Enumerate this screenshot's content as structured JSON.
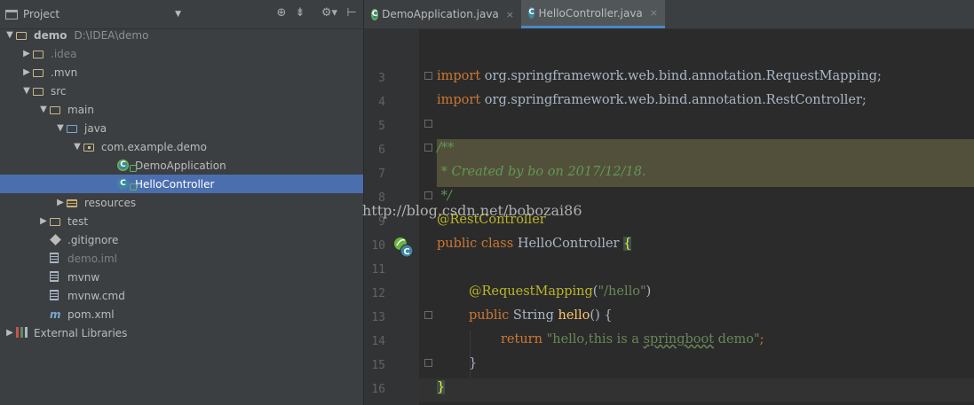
{
  "project_panel": {
    "title": "Project",
    "tree": [
      {
        "label": "demo",
        "path": "D:\\IDEA\\demo",
        "indent": 0,
        "expanded": true,
        "icon": "module-folder-icon",
        "bold": true
      },
      {
        "label": ".idea",
        "indent": 1,
        "expanded": false,
        "icon": "folder-icon",
        "dim": true
      },
      {
        "label": ".mvn",
        "indent": 1,
        "expanded": false,
        "icon": "folder-icon"
      },
      {
        "label": "src",
        "indent": 1,
        "expanded": true,
        "icon": "folder-icon"
      },
      {
        "label": "main",
        "indent": 2,
        "expanded": true,
        "icon": "folder-icon"
      },
      {
        "label": "java",
        "indent": 3,
        "expanded": true,
        "icon": "source-folder-icon"
      },
      {
        "label": "com.example.demo",
        "indent": 4,
        "expanded": true,
        "icon": "package-icon"
      },
      {
        "label": "DemoApplication",
        "indent": 6,
        "icon": "spring-boot-class-icon"
      },
      {
        "label": "HelloController",
        "indent": 6,
        "icon": "class-icon",
        "selected": true
      },
      {
        "label": "resources",
        "indent": 3,
        "expanded": false,
        "icon": "resources-folder-icon"
      },
      {
        "label": "test",
        "indent": 2,
        "expanded": false,
        "icon": "folder-icon"
      },
      {
        "label": ".gitignore",
        "indent": 2,
        "icon": "gitignore-icon"
      },
      {
        "label": "demo.iml",
        "indent": 2,
        "icon": "iml-file-icon",
        "dim": true
      },
      {
        "label": "mvnw",
        "indent": 2,
        "icon": "text-file-icon"
      },
      {
        "label": "mvnw.cmd",
        "indent": 2,
        "icon": "text-file-icon"
      },
      {
        "label": "pom.xml",
        "indent": 2,
        "icon": "maven-icon"
      },
      {
        "label": "External Libraries",
        "indent": 0,
        "expanded": false,
        "icon": "libraries-icon"
      }
    ]
  },
  "tabs": [
    {
      "label": "DemoApplication.java",
      "active": false
    },
    {
      "label": "HelloController.java",
      "active": true
    }
  ],
  "close_glyph": "×",
  "line_numbers": [
    "3",
    "4",
    "5",
    "6",
    "7",
    "8",
    "9",
    "10",
    "11",
    "12",
    "13",
    "14",
    "15",
    "16"
  ],
  "code": {
    "l3": {
      "kw": "import",
      "rest": " org.springframework.web.bind.annotation.RequestMapping;"
    },
    "l4": {
      "kw": "import",
      "rest": " org.springframework.web.bind.annotation.RestController;"
    },
    "l6": "/**",
    "l7": " * Created by bo on 2017/12/18.",
    "l8": " */",
    "l9": "@RestController",
    "l10": {
      "kw": "public class ",
      "name": "HelloController ",
      "brace": "{"
    },
    "l12": {
      "ann": "@RequestMapping",
      "open": "(",
      "str": "\"/hello\"",
      "close": ")"
    },
    "l13": {
      "kw": "public ",
      "type": "String ",
      "meth": "hello",
      "rest": "() {"
    },
    "l14": {
      "kw": "return ",
      "str_a": "\"hello,this is a ",
      "str_b": "springboot",
      "str_c": " demo\"",
      "semi": ";"
    },
    "l15": "}",
    "l16": "}"
  },
  "watermark": "http://blog.csdn.net/bobozai86"
}
